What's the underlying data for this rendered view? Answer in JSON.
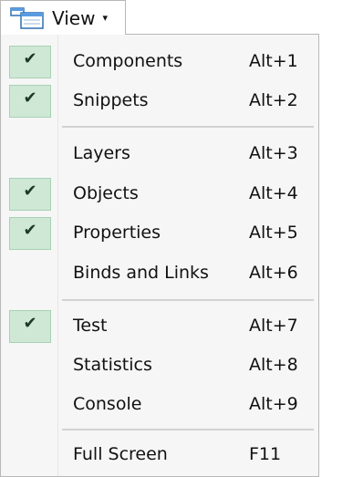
{
  "menubar": {
    "view_label": "View",
    "caret": "▾",
    "icon": "view-layout-icon"
  },
  "menu": {
    "items": [
      {
        "label": "Components",
        "shortcut": "Alt+1",
        "checked": true
      },
      {
        "label": "Snippets",
        "shortcut": "Alt+2",
        "checked": true
      },
      {
        "label": "Layers",
        "shortcut": "Alt+3",
        "checked": false
      },
      {
        "label": "Objects",
        "shortcut": "Alt+4",
        "checked": true
      },
      {
        "label": "Properties",
        "shortcut": "Alt+5",
        "checked": true
      },
      {
        "label": "Binds and Links",
        "shortcut": "Alt+6",
        "checked": false
      },
      {
        "label": "Test",
        "shortcut": "Alt+7",
        "checked": true
      },
      {
        "label": "Statistics",
        "shortcut": "Alt+8",
        "checked": false
      },
      {
        "label": "Console",
        "shortcut": "Alt+9",
        "checked": false
      },
      {
        "label": "Full Screen",
        "shortcut": "F11",
        "checked": false
      }
    ],
    "check_glyph": "✔"
  },
  "colors": {
    "check_bg": "#cfe8d6",
    "check_border": "#a7d1b3",
    "menu_bg": "#f6f6f6",
    "separator": "#d2d2d2"
  }
}
